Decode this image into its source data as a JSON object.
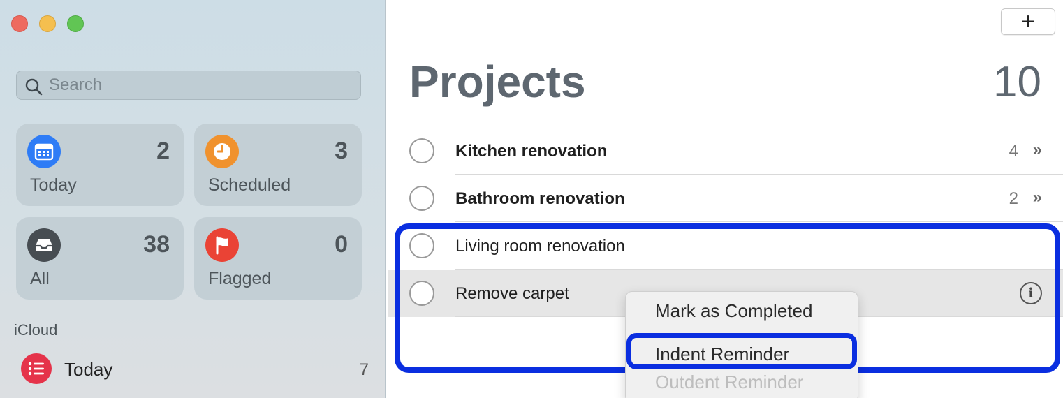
{
  "sidebar": {
    "search": {
      "placeholder": "Search"
    },
    "smart_lists": [
      {
        "label": "Today",
        "count": "2",
        "color": "#2e7cf6",
        "icon": "calendar-icon"
      },
      {
        "label": "Scheduled",
        "count": "3",
        "color": "#f0922e",
        "icon": "clock-icon"
      },
      {
        "label": "All",
        "count": "38",
        "color": "#474d52",
        "icon": "tray-icon"
      },
      {
        "label": "Flagged",
        "count": "0",
        "color": "#ea4335",
        "icon": "flag-icon"
      }
    ],
    "section": "iCloud",
    "lists": [
      {
        "label": "Today",
        "count": "7",
        "color": "#e5334a",
        "icon": "list-icon"
      }
    ]
  },
  "main": {
    "add_label": "+",
    "title": "Projects",
    "count": "10",
    "reminders": [
      {
        "text": "Kitchen renovation",
        "bold": true,
        "sub_count": "4",
        "chevron": "»"
      },
      {
        "text": "Bathroom renovation",
        "bold": true,
        "sub_count": "2",
        "chevron": "»"
      },
      {
        "text": "Living room renovation",
        "bold": false
      },
      {
        "text": "Remove carpet",
        "bold": false,
        "selected": true,
        "info": "i"
      }
    ]
  },
  "context_menu": {
    "items": [
      {
        "label": "Mark as Completed",
        "enabled": true
      },
      {
        "label": "Indent Reminder",
        "enabled": true,
        "highlighted": true
      },
      {
        "label": "Outdent Reminder",
        "enabled": false
      }
    ]
  },
  "colors": {
    "highlight_border": "#0a2ee0"
  }
}
